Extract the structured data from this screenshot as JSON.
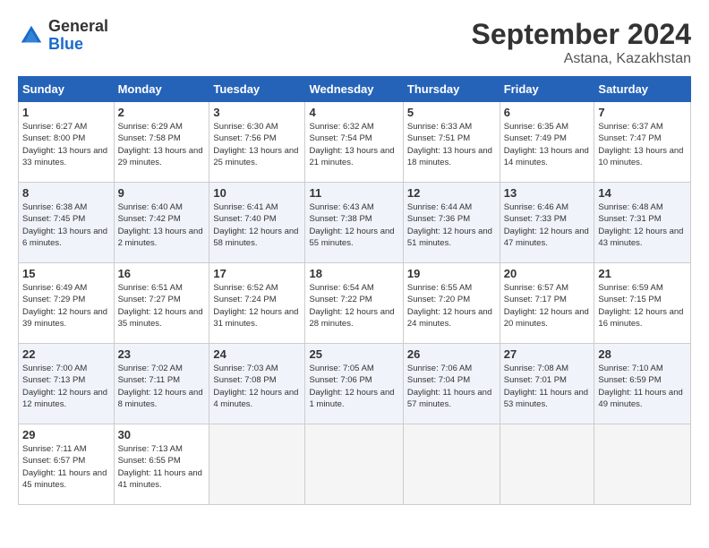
{
  "logo": {
    "general": "General",
    "blue": "Blue"
  },
  "title": "September 2024",
  "subtitle": "Astana, Kazakhstan",
  "days_of_week": [
    "Sunday",
    "Monday",
    "Tuesday",
    "Wednesday",
    "Thursday",
    "Friday",
    "Saturday"
  ],
  "weeks": [
    [
      {
        "day": "1",
        "sunrise": "6:27 AM",
        "sunset": "8:00 PM",
        "daylight": "13 hours and 33 minutes."
      },
      {
        "day": "2",
        "sunrise": "6:29 AM",
        "sunset": "7:58 PM",
        "daylight": "13 hours and 29 minutes."
      },
      {
        "day": "3",
        "sunrise": "6:30 AM",
        "sunset": "7:56 PM",
        "daylight": "13 hours and 25 minutes."
      },
      {
        "day": "4",
        "sunrise": "6:32 AM",
        "sunset": "7:54 PM",
        "daylight": "13 hours and 21 minutes."
      },
      {
        "day": "5",
        "sunrise": "6:33 AM",
        "sunset": "7:51 PM",
        "daylight": "13 hours and 18 minutes."
      },
      {
        "day": "6",
        "sunrise": "6:35 AM",
        "sunset": "7:49 PM",
        "daylight": "13 hours and 14 minutes."
      },
      {
        "day": "7",
        "sunrise": "6:37 AM",
        "sunset": "7:47 PM",
        "daylight": "13 hours and 10 minutes."
      }
    ],
    [
      {
        "day": "8",
        "sunrise": "6:38 AM",
        "sunset": "7:45 PM",
        "daylight": "13 hours and 6 minutes."
      },
      {
        "day": "9",
        "sunrise": "6:40 AM",
        "sunset": "7:42 PM",
        "daylight": "13 hours and 2 minutes."
      },
      {
        "day": "10",
        "sunrise": "6:41 AM",
        "sunset": "7:40 PM",
        "daylight": "12 hours and 58 minutes."
      },
      {
        "day": "11",
        "sunrise": "6:43 AM",
        "sunset": "7:38 PM",
        "daylight": "12 hours and 55 minutes."
      },
      {
        "day": "12",
        "sunrise": "6:44 AM",
        "sunset": "7:36 PM",
        "daylight": "12 hours and 51 minutes."
      },
      {
        "day": "13",
        "sunrise": "6:46 AM",
        "sunset": "7:33 PM",
        "daylight": "12 hours and 47 minutes."
      },
      {
        "day": "14",
        "sunrise": "6:48 AM",
        "sunset": "7:31 PM",
        "daylight": "12 hours and 43 minutes."
      }
    ],
    [
      {
        "day": "15",
        "sunrise": "6:49 AM",
        "sunset": "7:29 PM",
        "daylight": "12 hours and 39 minutes."
      },
      {
        "day": "16",
        "sunrise": "6:51 AM",
        "sunset": "7:27 PM",
        "daylight": "12 hours and 35 minutes."
      },
      {
        "day": "17",
        "sunrise": "6:52 AM",
        "sunset": "7:24 PM",
        "daylight": "12 hours and 31 minutes."
      },
      {
        "day": "18",
        "sunrise": "6:54 AM",
        "sunset": "7:22 PM",
        "daylight": "12 hours and 28 minutes."
      },
      {
        "day": "19",
        "sunrise": "6:55 AM",
        "sunset": "7:20 PM",
        "daylight": "12 hours and 24 minutes."
      },
      {
        "day": "20",
        "sunrise": "6:57 AM",
        "sunset": "7:17 PM",
        "daylight": "12 hours and 20 minutes."
      },
      {
        "day": "21",
        "sunrise": "6:59 AM",
        "sunset": "7:15 PM",
        "daylight": "12 hours and 16 minutes."
      }
    ],
    [
      {
        "day": "22",
        "sunrise": "7:00 AM",
        "sunset": "7:13 PM",
        "daylight": "12 hours and 12 minutes."
      },
      {
        "day": "23",
        "sunrise": "7:02 AM",
        "sunset": "7:11 PM",
        "daylight": "12 hours and 8 minutes."
      },
      {
        "day": "24",
        "sunrise": "7:03 AM",
        "sunset": "7:08 PM",
        "daylight": "12 hours and 4 minutes."
      },
      {
        "day": "25",
        "sunrise": "7:05 AM",
        "sunset": "7:06 PM",
        "daylight": "12 hours and 1 minute."
      },
      {
        "day": "26",
        "sunrise": "7:06 AM",
        "sunset": "7:04 PM",
        "daylight": "11 hours and 57 minutes."
      },
      {
        "day": "27",
        "sunrise": "7:08 AM",
        "sunset": "7:01 PM",
        "daylight": "11 hours and 53 minutes."
      },
      {
        "day": "28",
        "sunrise": "7:10 AM",
        "sunset": "6:59 PM",
        "daylight": "11 hours and 49 minutes."
      }
    ],
    [
      {
        "day": "29",
        "sunrise": "7:11 AM",
        "sunset": "6:57 PM",
        "daylight": "11 hours and 45 minutes."
      },
      {
        "day": "30",
        "sunrise": "7:13 AM",
        "sunset": "6:55 PM",
        "daylight": "11 hours and 41 minutes."
      },
      null,
      null,
      null,
      null,
      null
    ]
  ]
}
